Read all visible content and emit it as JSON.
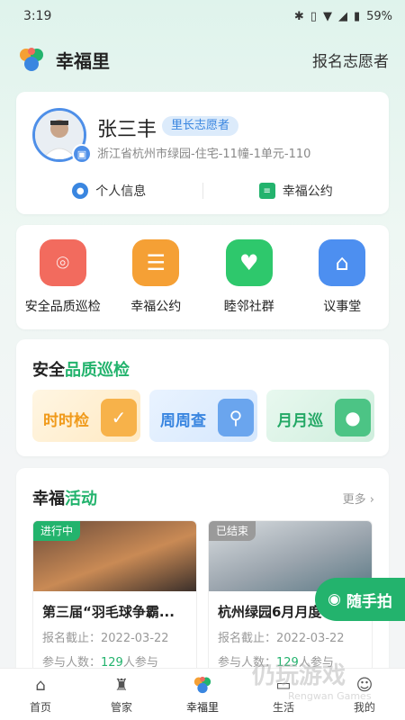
{
  "status_bar": {
    "time": "3:19",
    "battery": "59%"
  },
  "header": {
    "title": "幸福里",
    "action": "报名志愿者"
  },
  "profile": {
    "name": "张三丰",
    "role": "里长志愿者",
    "address": "浙江省杭州市绿园-住宅-11幢-1单元-110",
    "links": [
      {
        "label": "个人信息",
        "icon": "person-icon"
      },
      {
        "label": "幸福公约",
        "icon": "document-icon"
      }
    ]
  },
  "menu": [
    {
      "label": "安全品质巡检",
      "icon": "location-pin-icon",
      "color": "#f26b5e"
    },
    {
      "label": "幸福公约",
      "icon": "document-star-icon",
      "color": "#f5a035"
    },
    {
      "label": "睦邻社群",
      "icon": "chat-heart-icon",
      "color": "#2ec86c"
    },
    {
      "label": "议事堂",
      "icon": "house-chat-icon",
      "color": "#4d8ff0"
    }
  ],
  "inspection": {
    "title_plain": "安全",
    "title_accent": "品质巡检",
    "items": [
      {
        "label": "时时检",
        "color": "#f5a035"
      },
      {
        "label": "周周查",
        "color": "#3a86e0"
      },
      {
        "label": "月月巡",
        "color": "#2ec86c"
      }
    ]
  },
  "activities": {
    "title_plain": "幸福",
    "title_accent": "活动",
    "more": "更多",
    "items": [
      {
        "tag": "进行中",
        "title": "第三届“羽毛球争霸...",
        "deadline": "报名截止：2022-03-22",
        "participants_prefix": "参与人数：",
        "participants": "129",
        "participants_suffix": "人参与"
      },
      {
        "tag": "已结束",
        "title": "杭州绿园6月月度",
        "deadline": "报名截止：2022-03-22",
        "participants_prefix": "参与人数：",
        "participants": "129",
        "participants_suffix": "人参与"
      }
    ]
  },
  "snap_button": "随手拍",
  "tabs": [
    {
      "label": "首页",
      "icon": "home-icon"
    },
    {
      "label": "管家",
      "icon": "butler-icon"
    },
    {
      "label": "幸福里",
      "icon": "logo-icon"
    },
    {
      "label": "生活",
      "icon": "life-icon"
    },
    {
      "label": "我的",
      "icon": "profile-icon"
    }
  ],
  "watermark": {
    "text": "仍玩游戏",
    "sub": "Rengwan Games"
  }
}
